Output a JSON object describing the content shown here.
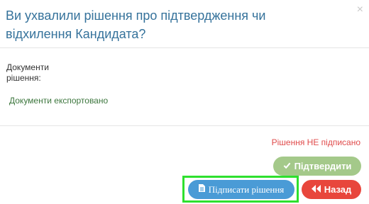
{
  "header": {
    "title": "Ви ухвалили рішення про підтвердження чи відхилення Кандидата?",
    "close_symbol": "×"
  },
  "body": {
    "documents_label": "Документи рішення:",
    "export_status": "Документи експортовано"
  },
  "footer": {
    "not_signed_text": "Рішення НЕ підписано",
    "confirm_label": "Підтвердити",
    "sign_label": "Підписати рішення",
    "back_label": "Назад",
    "icons": {
      "confirm": "check-icon",
      "sign": "document-icon",
      "back": "double-left-arrow-icon"
    }
  },
  "colors": {
    "title": "#35729b",
    "confirm_button": "#a4c98a",
    "sign_button": "#4a9bd6",
    "back_button": "#e8463c",
    "status_success": "#3c763d",
    "status_error": "#e04b4b",
    "highlight": "#2ee02e"
  }
}
